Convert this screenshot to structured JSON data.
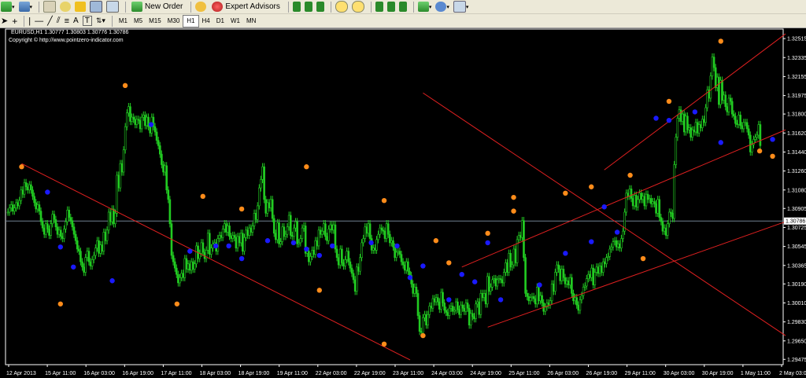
{
  "toolbar": {
    "new_order": "New Order",
    "expert_advisors": "Expert Advisors",
    "text_tool": "A",
    "label_tool": "T",
    "timeframes": [
      "M1",
      "M5",
      "M15",
      "M30",
      "H1",
      "H4",
      "D1",
      "W1",
      "MN"
    ],
    "active_timeframe": "H1"
  },
  "chart_header": {
    "symbol_line": "EURUSD,H1  1.30777 1.30803 1.30776 1.30786",
    "copyright": "Copyright © http://www.pointzero-indicator.com"
  },
  "chart_data": {
    "type": "candlestick",
    "symbol": "EURUSD",
    "timeframe": "H1",
    "last_price": 1.30786,
    "y_ticks": [
      1.32515,
      1.32335,
      1.32155,
      1.31975,
      1.318,
      1.3162,
      1.3144,
      1.3126,
      1.3108,
      1.30905,
      1.30725,
      1.30545,
      1.30365,
      1.3019,
      1.3001,
      1.2983,
      1.2965,
      1.29475
    ],
    "ylim": [
      1.29425,
      1.32605
    ],
    "x_labels": [
      "12 Apr 2013",
      "15 Apr 11:00",
      "16 Apr 03:00",
      "16 Apr 19:00",
      "17 Apr 11:00",
      "18 Apr 03:00",
      "18 Apr 19:00",
      "19 Apr 11:00",
      "22 Apr 03:00",
      "22 Apr 19:00",
      "23 Apr 11:00",
      "24 Apr 03:00",
      "24 Apr 19:00",
      "25 Apr 11:00",
      "26 Apr 03:00",
      "26 Apr 19:00",
      "29 Apr 11:00",
      "30 Apr 03:00",
      "30 Apr 19:00",
      "1 May 11:00",
      "2 May 03:00"
    ],
    "closes": [
      1.3087,
      1.3091,
      1.3094,
      1.3088,
      1.3091,
      1.3096,
      1.3093,
      1.3098,
      1.3108,
      1.3104,
      1.3115,
      1.3111,
      1.3108,
      1.3113,
      1.3108,
      1.3102,
      1.3096,
      1.309,
      1.3094,
      1.3088,
      1.3078,
      1.3072,
      1.3066,
      1.3076,
      1.3071,
      1.3065,
      1.3076,
      1.3085,
      1.308,
      1.3073,
      1.3066,
      1.307,
      1.3064,
      1.3062,
      1.3071,
      1.3078,
      1.3089,
      1.3082,
      1.3079,
      1.3073,
      1.3066,
      1.306,
      1.3052,
      1.305,
      1.304,
      1.3035,
      1.303,
      1.3044,
      1.305,
      1.304,
      1.3036,
      1.3042,
      1.3046,
      1.3053,
      1.306,
      1.3048,
      1.3056,
      1.305,
      1.3068,
      1.306,
      1.307,
      1.3087,
      1.3078,
      1.309,
      1.3076,
      1.3086,
      1.3122,
      1.311,
      1.3133,
      1.3125,
      1.3146,
      1.3168,
      1.3181,
      1.3187,
      1.3173,
      1.3177,
      1.3175,
      1.317,
      1.3175,
      1.3174,
      1.3166,
      1.3177,
      1.3179,
      1.3169,
      1.3177,
      1.3168,
      1.3162,
      1.3177,
      1.3168,
      1.3163,
      1.3155,
      1.315,
      1.3142,
      1.3132,
      1.3125,
      1.3131,
      1.3108,
      1.3099,
      1.3076,
      1.3046,
      1.304,
      1.3034,
      1.3028,
      1.302,
      1.3025,
      1.3029,
      1.3025,
      1.3043,
      1.3033,
      1.3038,
      1.3032,
      1.304,
      1.3033,
      1.3038,
      1.3055,
      1.3043,
      1.3048,
      1.3058,
      1.3049,
      1.3043,
      1.3051,
      1.3067,
      1.3047,
      1.3053,
      1.3057,
      1.3058,
      1.305,
      1.3062,
      1.3065,
      1.3063,
      1.3071,
      1.3076,
      1.3068,
      1.3074,
      1.3064,
      1.3062,
      1.3065,
      1.3063,
      1.3053,
      1.3064,
      1.3058,
      1.3067,
      1.305,
      1.3063,
      1.307,
      1.3065,
      1.3072,
      1.3068,
      1.3074,
      1.3086,
      1.308,
      1.3093,
      1.311,
      1.3118,
      1.313,
      1.3099,
      1.3086,
      1.3096,
      1.3091,
      1.3099,
      1.3081,
      1.3067,
      1.3061,
      1.3077,
      1.3057,
      1.3059,
      1.3073,
      1.3064,
      1.3066,
      1.3073,
      1.3084,
      1.3065,
      1.3064,
      1.3072,
      1.3078,
      1.3057,
      1.3058,
      1.3062,
      1.3072,
      1.3074,
      1.3048,
      1.305,
      1.304,
      1.3045,
      1.3051,
      1.3047,
      1.306,
      1.3055,
      1.307,
      1.3066,
      1.3069,
      1.3076,
      1.3064,
      1.306,
      1.3071,
      1.3075,
      1.307,
      1.3075,
      1.3052,
      1.3044,
      1.3037,
      1.3052,
      1.3039,
      1.3036,
      1.3042,
      1.305,
      1.304,
      1.3034,
      1.3029,
      1.3023,
      1.3012,
      1.3035,
      1.3031,
      1.3044,
      1.3058,
      1.3062,
      1.3073,
      1.3067,
      1.3076,
      1.3062,
      1.3051,
      1.3053,
      1.3051,
      1.3061,
      1.3066,
      1.3072,
      1.307,
      1.3069,
      1.3062,
      1.3076,
      1.3066,
      1.3058,
      1.306,
      1.3054,
      1.3044,
      1.3049,
      1.305,
      1.3047,
      1.304,
      1.3037,
      1.3032,
      1.304,
      1.3031,
      1.3027,
      1.3019,
      1.301,
      1.3016,
      1.301,
      1.2989,
      1.2974,
      1.2973,
      1.2987,
      1.299,
      1.298,
      1.299,
      1.2998,
      1.2996,
      1.3005,
      1.3002,
      1.3006,
      1.3002,
      1.2995,
      1.3011,
      1.3001,
      1.2994,
      1.2992,
      1.2989,
      1.2996,
      1.2998,
      1.2993,
      1.2994,
      1.3002,
      1.2995,
      1.299,
      1.2999,
      1.2996,
      1.2993,
      1.3001,
      1.2996,
      1.298,
      1.2991,
      1.2988,
      1.2986,
      1.3,
      1.3002,
      1.299,
      1.301,
      1.3006,
      1.301,
      1.3,
      1.3026,
      1.3012,
      1.3016,
      1.3023,
      1.3024,
      1.3017,
      1.3023,
      1.3024,
      1.3023,
      1.302,
      1.303,
      1.3039,
      1.303,
      1.3048,
      1.3035,
      1.3037,
      1.3052,
      1.3039,
      1.3061,
      1.3065,
      1.3063,
      1.3079,
      1.3044,
      1.301,
      1.3007,
      1.3003,
      1.3006,
      1.3007,
      1.3005,
      1.3,
      1.3016,
      1.3003,
      1.3008,
      1.3001,
      1.2993,
      1.2997,
      1.3001,
      1.2999,
      1.3003,
      1.3019,
      1.3012,
      1.303,
      1.3037,
      1.3033,
      1.3022,
      1.3033,
      1.3025,
      1.3019,
      1.3022,
      1.3018,
      1.3025,
      1.301,
      1.3003,
      1.3006,
      1.2999,
      1.2994,
      1.3004,
      1.3008,
      1.3016,
      1.3017,
      1.3024,
      1.3028,
      1.3025,
      1.3034,
      1.3018,
      1.303,
      1.3035,
      1.3029,
      1.3036,
      1.303,
      1.304,
      1.3038,
      1.3044,
      1.3045,
      1.3052,
      1.3054,
      1.3059,
      1.306,
      1.3054,
      1.3057,
      1.3053,
      1.3062,
      1.3069,
      1.3087,
      1.3105,
      1.3102,
      1.3109,
      1.31,
      1.3093,
      1.3103,
      1.3092,
      1.3099,
      1.3105,
      1.3099,
      1.3102,
      1.3093,
      1.3104,
      1.3099,
      1.31,
      1.3095,
      1.3097,
      1.3095,
      1.3086,
      1.3099,
      1.3082,
      1.3078,
      1.3069,
      1.3072,
      1.3065,
      1.3076,
      1.3087,
      1.3086,
      1.3081,
      1.3132,
      1.3158,
      1.3176,
      1.3184,
      1.3173,
      1.318,
      1.3163,
      1.3178,
      1.3165,
      1.3167,
      1.3158,
      1.3165,
      1.3163,
      1.3172,
      1.3162,
      1.317,
      1.3167,
      1.3175,
      1.3172,
      1.3186,
      1.3203,
      1.3195,
      1.3216,
      1.3234,
      1.3224,
      1.3205,
      1.3215,
      1.3189,
      1.3212,
      1.3193,
      1.3198,
      1.3187,
      1.3182,
      1.3195,
      1.3192,
      1.318,
      1.3178,
      1.3171,
      1.317,
      1.3179,
      1.3169,
      1.3166,
      1.3172,
      1.3172,
      1.3166,
      1.316,
      1.3144,
      1.3151,
      1.3156,
      1.3158,
      1.316,
      1.317,
      1.315
    ],
    "price_line": 1.30786,
    "trend_lines": [
      {
        "from": [
          1,
          1.3133
        ],
        "to": [
          31,
          1.2947
        ],
        "color": "#e02020"
      },
      {
        "from": [
          32,
          1.32
        ],
        "to": [
          60,
          1.297
        ],
        "color": "#e02020"
      },
      {
        "from": [
          35,
          1.3035
        ],
        "to": [
          60,
          1.3165
        ],
        "color": "#e02020"
      },
      {
        "from": [
          37,
          1.2978
        ],
        "to": [
          60,
          1.3078
        ],
        "color": "#e02020"
      },
      {
        "from": [
          46,
          1.3127
        ],
        "to": [
          60,
          1.3256
        ],
        "color": "#e02020"
      }
    ],
    "fractals_up": [
      [
        1,
        1.313
      ],
      [
        9,
        1.3207
      ],
      [
        18,
        1.309
      ],
      [
        23,
        1.313
      ],
      [
        29,
        1.3098
      ],
      [
        34,
        1.3039
      ],
      [
        37,
        1.3067
      ],
      [
        39,
        1.3101
      ],
      [
        45,
        1.3111
      ],
      [
        48,
        1.3122
      ],
      [
        51,
        1.3192
      ],
      [
        55,
        1.3249
      ],
      [
        59,
        1.314
      ]
    ],
    "fractals_down": [
      [
        -1,
        1.3118
      ],
      [
        3,
        1.3106
      ],
      [
        4,
        1.3054
      ],
      [
        5,
        1.3035
      ],
      [
        8,
        1.3022
      ],
      [
        11,
        1.317
      ],
      [
        14,
        1.305
      ],
      [
        16,
        1.3055
      ],
      [
        17,
        1.3055
      ],
      [
        18,
        1.3043
      ],
      [
        20,
        1.306
      ],
      [
        22,
        1.3058
      ],
      [
        23,
        1.3052
      ],
      [
        24,
        1.3046
      ],
      [
        25,
        1.3055
      ],
      [
        28,
        1.3058
      ],
      [
        30,
        1.3055
      ],
      [
        31,
        1.3025
      ],
      [
        32,
        1.3036
      ],
      [
        34,
        1.3004
      ],
      [
        35,
        1.3028
      ],
      [
        36,
        1.3021
      ],
      [
        37,
        1.3058
      ],
      [
        38,
        1.3004
      ],
      [
        41,
        1.3018
      ],
      [
        43,
        1.3048
      ],
      [
        45,
        1.3059
      ],
      [
        46,
        1.3092
      ],
      [
        47,
        1.3068
      ],
      [
        50,
        1.3176
      ],
      [
        51,
        1.3174
      ],
      [
        53,
        1.3182
      ],
      [
        55,
        1.3153
      ],
      [
        59,
        1.3156
      ]
    ],
    "fractals_orange": [
      [
        15,
        1.3102
      ],
      [
        4,
        1.3
      ],
      [
        13,
        1.3
      ],
      [
        24,
        1.3013
      ],
      [
        29,
        1.2962
      ],
      [
        33,
        1.306
      ],
      [
        32,
        1.297
      ],
      [
        39,
        1.3088
      ],
      [
        43,
        1.3105
      ],
      [
        49,
        1.3043
      ],
      [
        58,
        1.3145
      ]
    ],
    "colors": {
      "candle": "#22cc22",
      "background": "#000000",
      "grid_axis": "#ffffff",
      "trend": "#e02020",
      "fractal_up": "#ff8c1a",
      "fractal_down": "#1a1aff",
      "price_line": "#708090"
    }
  }
}
